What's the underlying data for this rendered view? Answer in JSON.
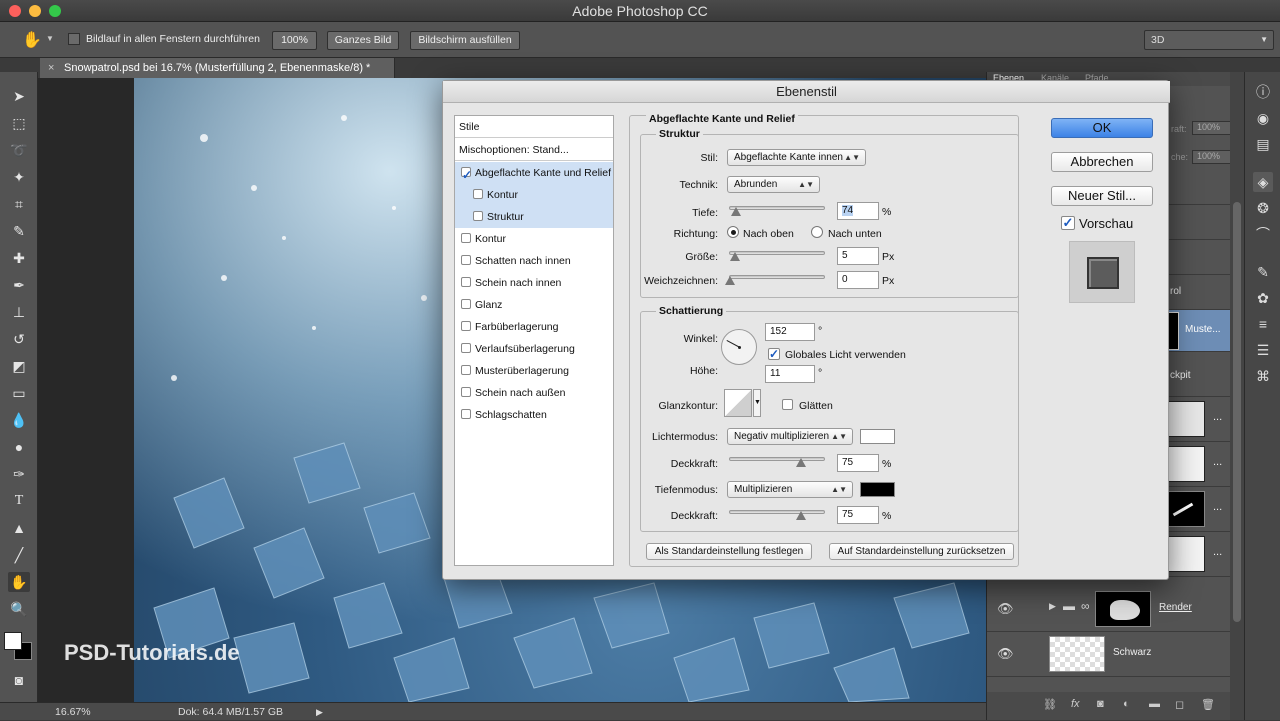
{
  "app": {
    "title": "Adobe Photoshop CC"
  },
  "options_bar": {
    "scroll_all_label": "Bildlauf in allen Fenstern durchführen",
    "zoom100": "100%",
    "fit_screen": "Ganzes Bild",
    "fill_screen": "Bildschirm ausfüllen",
    "workspace": "3D"
  },
  "document": {
    "tab_title": "Snowpatrol.psd bei 16.7% (Musterfüllung 2, Ebenenmaske/8) *"
  },
  "status_bar": {
    "zoom": "16.67%",
    "doc_info": "Dok: 64.4 MB/1.57 GB"
  },
  "layers_panel": {
    "tabs": [
      "Ebenen",
      "Kanäle",
      "Pfade"
    ],
    "fill_label": "raft:",
    "fill_value": "100%",
    "opacity_label": "che:",
    "opacity_value": "100%",
    "partial_labels": [
      "rol",
      "Muste...",
      "ckpit"
    ],
    "rows": [
      {
        "name": "Render"
      },
      {
        "name": "Schwarz"
      }
    ]
  },
  "watermark": "PSD-Tutorials.de",
  "dialog": {
    "title": "Ebenenstil",
    "buttons": {
      "ok": "OK",
      "cancel": "Abbrechen",
      "new_style": "Neuer Stil...",
      "preview": "Vorschau"
    },
    "styles_header": "Stile",
    "blend_options": "Mischoptionen: Stand...",
    "style_items": [
      {
        "label": "Abgeflachte Kante und Relief",
        "checked": true,
        "indent": false,
        "selected": true
      },
      {
        "label": "Kontur",
        "checked": false,
        "indent": true,
        "selected": true
      },
      {
        "label": "Struktur",
        "checked": false,
        "indent": true,
        "selected": true
      },
      {
        "label": "Kontur",
        "checked": false,
        "indent": false,
        "selected": false
      },
      {
        "label": "Schatten nach innen",
        "checked": false,
        "indent": false,
        "selected": false
      },
      {
        "label": "Schein nach innen",
        "checked": false,
        "indent": false,
        "selected": false
      },
      {
        "label": "Glanz",
        "checked": false,
        "indent": false,
        "selected": false
      },
      {
        "label": "Farbüberlagerung",
        "checked": false,
        "indent": false,
        "selected": false
      },
      {
        "label": "Verlaufsüberlagerung",
        "checked": false,
        "indent": false,
        "selected": false
      },
      {
        "label": "Musterüberlagerung",
        "checked": false,
        "indent": false,
        "selected": false
      },
      {
        "label": "Schein nach außen",
        "checked": false,
        "indent": false,
        "selected": false
      },
      {
        "label": "Schlagschatten",
        "checked": false,
        "indent": false,
        "selected": false
      }
    ],
    "bevel": {
      "section_title": "Abgeflachte Kante und Relief",
      "structure_title": "Struktur",
      "style_label": "Stil:",
      "style_value": "Abgeflachte Kante innen",
      "technique_label": "Technik:",
      "technique_value": "Abrunden",
      "depth_label": "Tiefe:",
      "depth_value": "74",
      "depth_unit": "%",
      "direction_label": "Richtung:",
      "dir_up": "Nach oben",
      "dir_down": "Nach unten",
      "size_label": "Größe:",
      "size_value": "5",
      "size_unit": "Px",
      "soften_label": "Weichzeichnen:",
      "soften_value": "0",
      "soften_unit": "Px"
    },
    "shading": {
      "title": "Schattierung",
      "angle_label": "Winkel:",
      "angle_value": "152",
      "degree": "°",
      "global_light": "Globales Licht verwenden",
      "altitude_label": "Höhe:",
      "altitude_value": "11",
      "gloss_label": "Glanzkontur:",
      "antialias": "Glätten",
      "highlight_mode_label": "Lichtermodus:",
      "highlight_mode_value": "Negativ multiplizieren",
      "highlight_opacity_label": "Deckkraft:",
      "highlight_opacity_value": "75",
      "pct": "%",
      "shadow_mode_label": "Tiefenmodus:",
      "shadow_mode_value": "Multiplizieren",
      "shadow_opacity_label": "Deckkraft:",
      "shadow_opacity_value": "75",
      "highlight_color": "#ffffff",
      "shadow_color": "#000000"
    },
    "make_default": "Als Standardeinstellung festlegen",
    "reset_default": "Auf Standardeinstellung zurücksetzen"
  }
}
